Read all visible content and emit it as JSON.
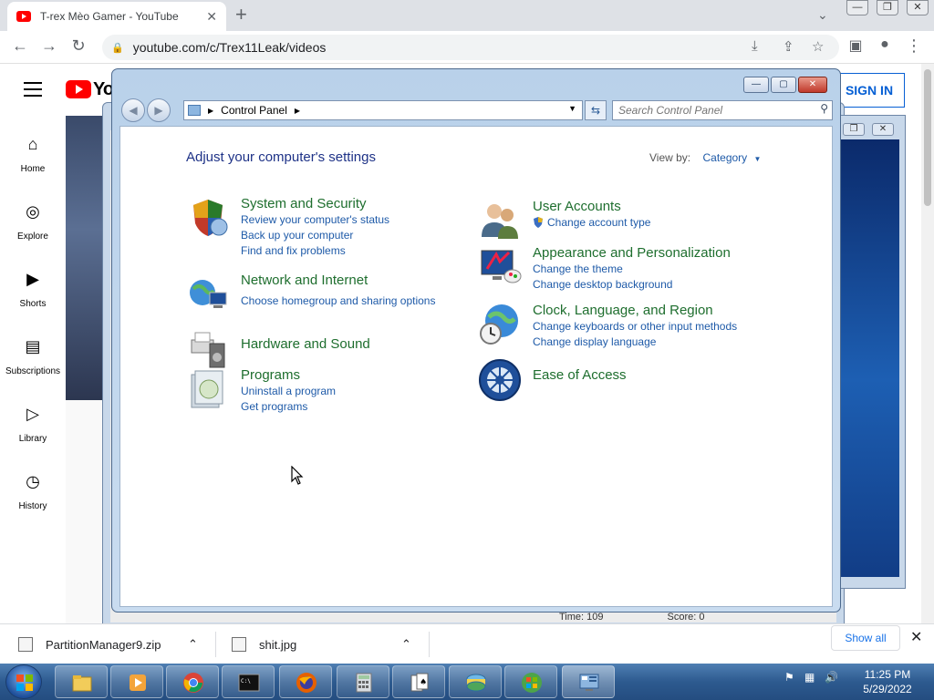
{
  "browser": {
    "tab_title": "T-rex Mèo Gamer - YouTube",
    "new_tab": "+",
    "tab_close": "✕",
    "url": "youtube.com/c/Trex11Leak/videos",
    "win_min": "—",
    "win_max": "❐",
    "win_close": "✕"
  },
  "youtube": {
    "logo_text": "Yo",
    "sign_in": "SIGN IN",
    "guide": [
      {
        "label": "Home",
        "icon": "home-icon"
      },
      {
        "label": "Explore",
        "icon": "compass-icon"
      },
      {
        "label": "Shorts",
        "icon": "shorts-icon"
      },
      {
        "label": "Subscriptions",
        "icon": "subscriptions-icon"
      },
      {
        "label": "Library",
        "icon": "library-icon"
      },
      {
        "label": "History",
        "icon": "history-icon"
      }
    ]
  },
  "bg_window": {
    "time_label": "Time:  109",
    "score_label": "Score: 0"
  },
  "control_panel": {
    "address": "Control Panel",
    "search_placeholder": "Search Control Panel",
    "heading": "Adjust your computer's settings",
    "view_by_label": "View by:",
    "view_by_value": "Category",
    "left_categories": [
      {
        "title": "System and Security",
        "icon": "shield-icon",
        "links": [
          "Review your computer's status",
          "Back up your computer",
          "Find and fix problems"
        ]
      },
      {
        "title": "Network and Internet",
        "icon": "network-icon",
        "links": [
          "Choose homegroup and sharing options"
        ]
      },
      {
        "title": "Hardware and Sound",
        "icon": "printer-speaker-icon",
        "links": []
      },
      {
        "title": "Programs",
        "icon": "programs-icon",
        "links": [
          "Uninstall a program",
          "Get programs"
        ]
      }
    ],
    "right_categories": [
      {
        "title": "User Accounts",
        "icon": "users-icon",
        "links": [
          "Change account type"
        ]
      },
      {
        "title": "Appearance and Personalization",
        "icon": "monitor-palette-icon",
        "links": [
          "Change the theme",
          "Change desktop background"
        ]
      },
      {
        "title": "Clock, Language, and Region",
        "icon": "globe-clock-icon",
        "links": [
          "Change keyboards or other input methods",
          "Change display language"
        ]
      },
      {
        "title": "Ease of Access",
        "icon": "accessibility-icon",
        "links": []
      }
    ]
  },
  "downloads": {
    "items": [
      "PartitionManager9.zip",
      "shit.jpg"
    ],
    "show_all": "Show all"
  },
  "taskbar": {
    "time": "11:25 PM",
    "date": "5/29/2022"
  },
  "colors": {
    "category_title": "#1e6e2e",
    "link": "#1e5aa8",
    "heading": "#1e3287",
    "youtube_red": "#ff0000"
  }
}
